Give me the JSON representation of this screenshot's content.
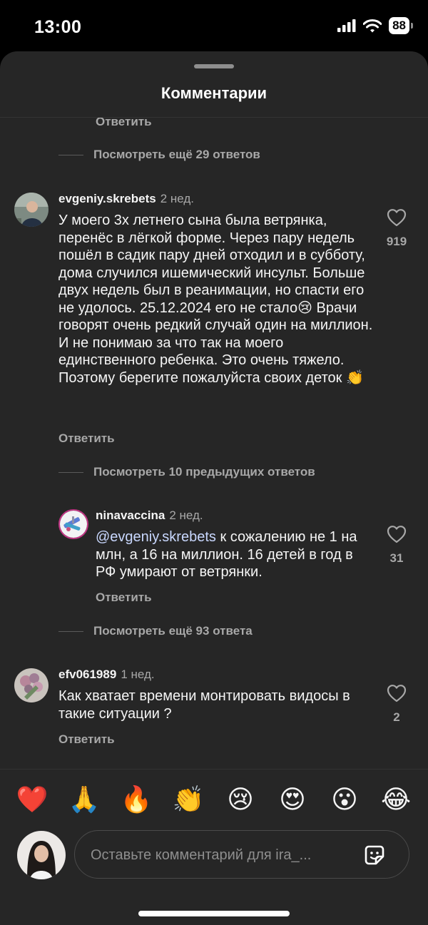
{
  "status_bar": {
    "time": "13:00",
    "battery": "88"
  },
  "sheet": {
    "title": "Комментарии"
  },
  "thread": {
    "top_reply_label": "Ответить",
    "top_more": "Посмотреть ещё 29 ответов"
  },
  "comments": [
    {
      "username": "evgeniy.skrebets",
      "time": "2 нед.",
      "text": "У моего 3х летнего сына была ветрянка, перенёс в лёгкой форме. Через пару недель пошёл в садик пару дней отходил и в субботу, дома случился ишемический инсульт. Больше двух недель был в реанимации, но спасти его не удолось. 25.12.2024 его не стало😢 Врачи говорят очень редкий случай один на миллион. И не понимаю за что так на моего единственного ребенка. Это очень тяжело. Поэтому берегите пожалуйста своих деток 👏",
      "likes": "919",
      "reply_label": "Ответить",
      "more_replies": "Посмотреть 10 предыдущих ответов"
    },
    {
      "username": "ninavaccina",
      "time": "2 нед.",
      "mention": "@evgeniy.skrebets",
      "text": " к сожалению не 1 на млн, а 16 на миллион. 16 детей в год в РФ умирают от ветрянки.",
      "likes": "31",
      "reply_label": "Ответить",
      "more_replies": "Посмотреть ещё 93 ответа"
    },
    {
      "username": "efv061989",
      "time": "1 нед.",
      "text": "Как хватает времени монтировать видосы в такие ситуации ?",
      "likes": "2",
      "reply_label": "Ответить"
    }
  ],
  "reactions": [
    "❤️",
    "🙏",
    "🔥",
    "👏",
    "😢",
    "😍",
    "😮",
    "😂"
  ],
  "composer": {
    "placeholder": "Оставьте комментарий для ira_..."
  },
  "icons": {
    "heart": "heart-icon",
    "signal": "signal-icon",
    "wifi": "wifi-icon",
    "battery": "battery-icon",
    "sticker": "sticker-icon"
  },
  "colors": {
    "sheet_bg": "#262626",
    "text": "#f5f5f5",
    "muted": "#a8a8a8",
    "mention": "#c9d8ff"
  }
}
